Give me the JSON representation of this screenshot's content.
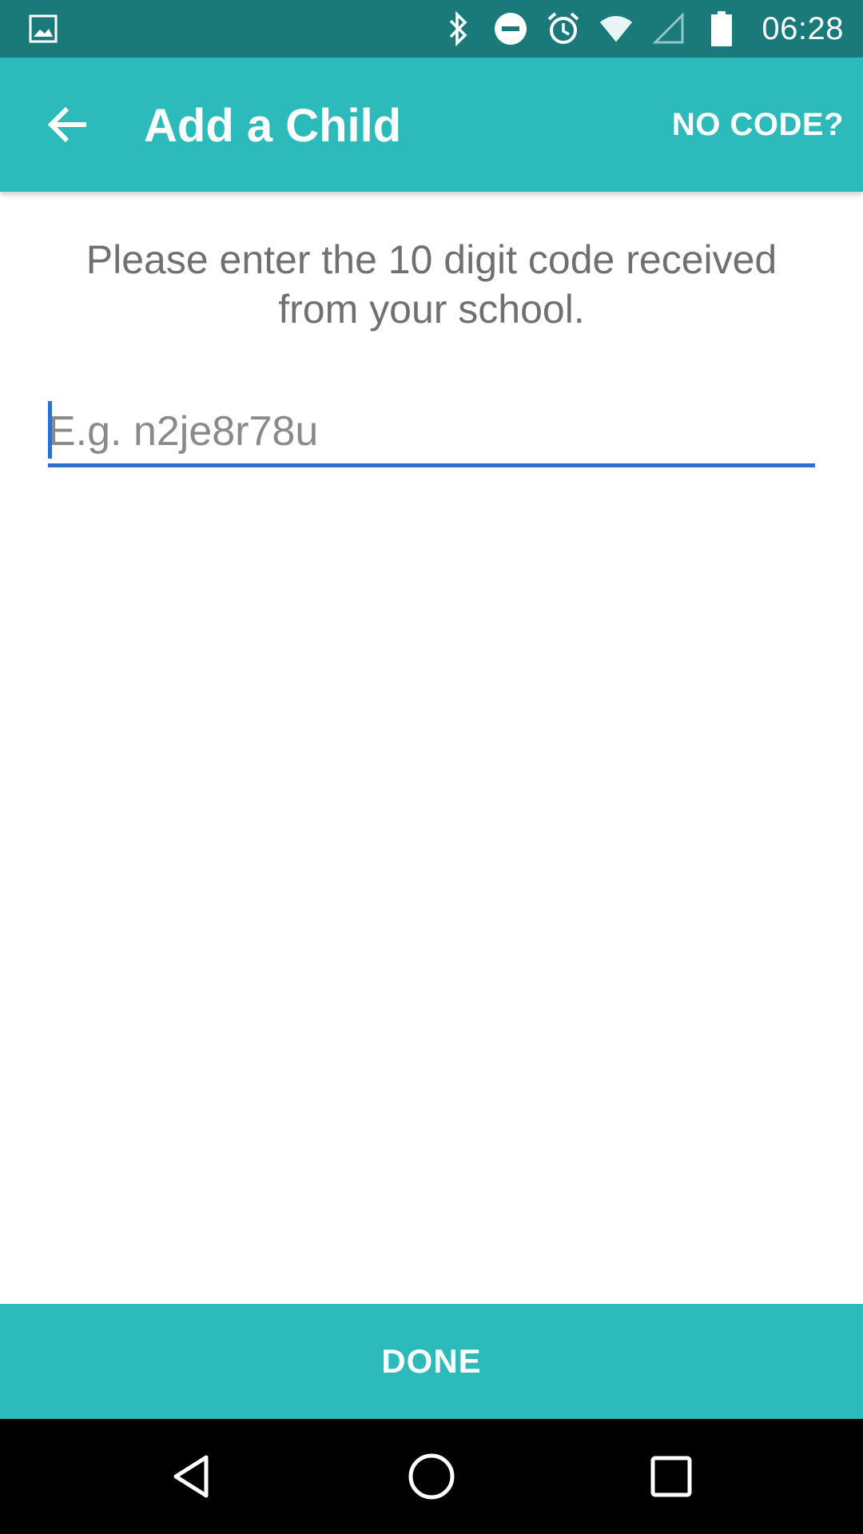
{
  "status_bar": {
    "time": "06:28",
    "icons": [
      "gallery-icon",
      "bluetooth-icon",
      "do-not-disturb-icon",
      "alarm-icon",
      "wifi-icon",
      "cell-signal-icon",
      "battery-icon"
    ]
  },
  "app_bar": {
    "title": "Add a Child",
    "action_label": "NO CODE?",
    "back_icon": "arrow-back-icon"
  },
  "content": {
    "instructions": "Please enter the 10 digit code received from your school.",
    "code_input": {
      "value": "",
      "placeholder": "E.g. n2je8r78u"
    }
  },
  "footer": {
    "done_label": "DONE"
  },
  "nav_bar": {
    "icons": [
      "back-triangle-icon",
      "home-circle-icon",
      "recents-square-icon"
    ]
  },
  "colors": {
    "status_bar": "#1a7a7a",
    "primary": "#2cbaba",
    "accent": "#2f6fd0",
    "text_muted": "#707070",
    "nav_bar": "#000000"
  }
}
